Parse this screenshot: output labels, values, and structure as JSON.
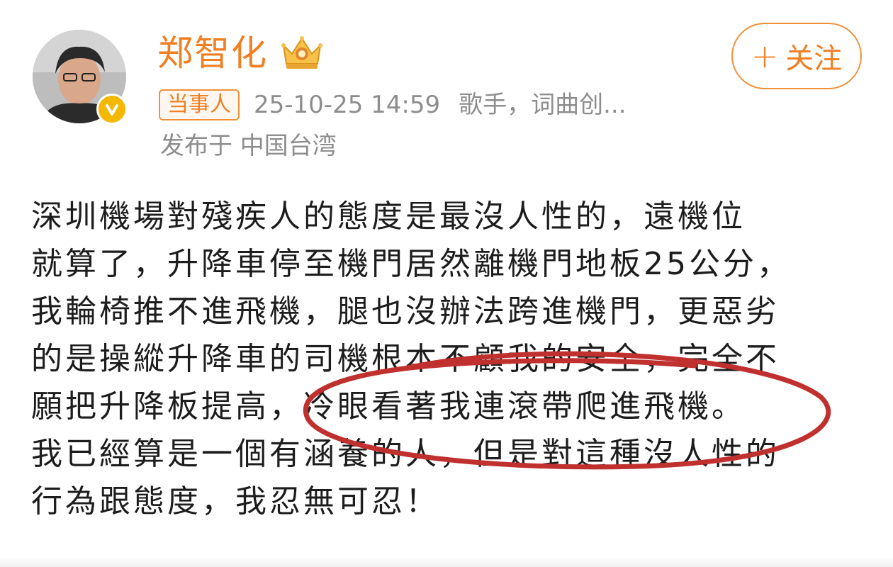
{
  "author": {
    "name": "郑智化",
    "avatar_icon": "avatar-photo",
    "verified_icon": "verified-check-icon",
    "crown_icon": "crown-badge-icon"
  },
  "follow_button": {
    "plus": "+",
    "label": "关注"
  },
  "meta": {
    "tag": "当事人",
    "timestamp": "25-10-25 14:59",
    "bio": "歌手，词曲创...",
    "location": "发布于 中国台湾"
  },
  "post": {
    "lines": [
      "深圳機場對殘疾人的態度是最沒人性的，遠機位",
      "就算了，升降車停至機門居然離機門地板25公分，",
      "我輪椅推不進飛機，腿也沒辦法跨進機門，更惡劣",
      "的是操縱升降車的司機根本不顧我的安全，完全不",
      "願把升降板提高，冷眼看著我連滾帶爬進飛機。",
      "我已經算是一個有涵養的人，但是對這種沒人性的",
      "行為跟態度，我忍無可忍！"
    ]
  },
  "colors": {
    "accent": "#f07f22",
    "annotation": "#c0302f",
    "muted_text": "#8d8d8d"
  }
}
